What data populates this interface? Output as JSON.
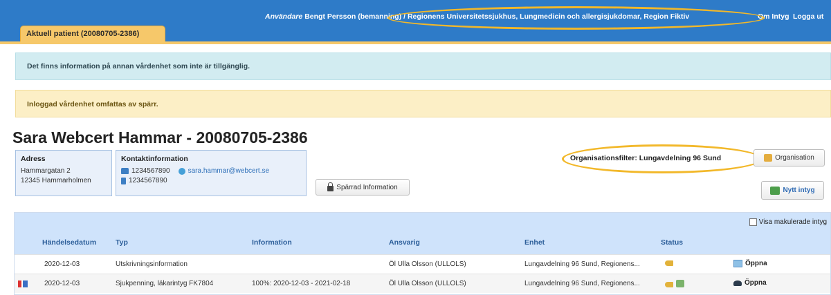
{
  "header": {
    "user_label": "Användare",
    "user_info": "Bengt Persson (bemanning) / Regionens Universitetssjukhus, Lungmedicin och allergisjukdomar, Region Fiktiv",
    "link_intyg": "Om Intyg",
    "link_logout": "Logga ut",
    "accent_color": "#2e7bc8"
  },
  "tab": {
    "label": "Aktuell patient (20080705-2386)",
    "color": "#f6c86a"
  },
  "alerts": {
    "info": "Det finns information på annan vårdenhet som inte är tillgänglig.",
    "warning": "Inloggad vårdenhet omfattas av spärr."
  },
  "patient": {
    "title": "Sara Webcert Hammar - 20080705-2386",
    "address": {
      "title": "Adress",
      "line1": "Hammargatan 2",
      "line2": "12345 Hammarholmen"
    },
    "contact": {
      "title": "Kontaktinformation",
      "phone": "1234567890",
      "email": "sara.hammar@webcert.se",
      "mobile": "1234567890"
    },
    "sparrad_button": "Spärrad Information"
  },
  "org_filter": {
    "label": "Organisationsfilter: Lungavdelning 96 Sund",
    "org_button": "Organisation",
    "new_button": "Nytt intyg"
  },
  "table": {
    "show_cancelled": "Visa makulerade intyg",
    "columns": [
      "Händelsedatum",
      "Typ",
      "Information",
      "Ansvarig",
      "Enhet",
      "Status"
    ],
    "open_label": "Öppna",
    "rows": [
      {
        "date": "2020-12-03",
        "type": "Utskrivningsinformation",
        "info": "",
        "responsible": "Öl Ulla Olsson (ULLOLS)",
        "unit": "Lungavdelning 96 Sund, Regionens...",
        "status_icons": [
          "key-icon"
        ],
        "open_icon": "certificate-icon",
        "flag": false
      },
      {
        "date": "2020-12-03",
        "type": "Sjukpenning, läkarintyg FK7804",
        "info": "100%: 2020-12-03 - 2021-02-18",
        "responsible": "Öl Ulla Olsson (ULLOLS)",
        "unit": "Lungavdelning 96 Sund, Regionens...",
        "status_icons": [
          "key-icon",
          "document-icon"
        ],
        "open_icon": "graduation-hat-icon",
        "flag": true
      }
    ]
  },
  "highlight_color": "#f2b82a"
}
